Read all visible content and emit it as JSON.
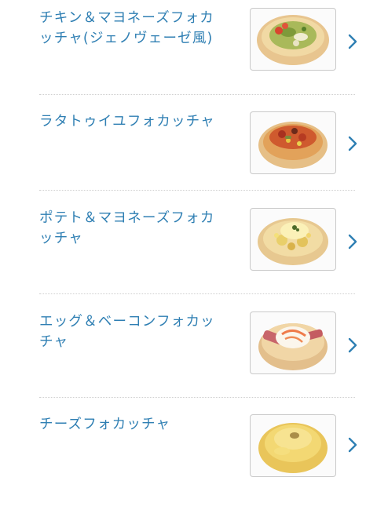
{
  "colors": {
    "item_text": "#2f7fb3",
    "chevron": "#2f7fb3",
    "divider": "#cfcfcf",
    "thumb_border": "#c9c9c9"
  },
  "items": [
    {
      "name": "チキン＆マヨネーズフォカ\nッチャ(ジェノヴェーゼ風)",
      "image": "chicken-mayo-genovese-focaccia",
      "icon": "chevron-right-icon"
    },
    {
      "name": "ラタトゥイユフォカッチャ",
      "image": "ratatouille-focaccia",
      "icon": "chevron-right-icon"
    },
    {
      "name": "ポテト＆マヨネーズフォカ\nッチャ",
      "image": "potato-mayo-focaccia",
      "icon": "chevron-right-icon"
    },
    {
      "name": "エッグ＆ベーコンフォカッ\nチャ",
      "image": "egg-bacon-focaccia",
      "icon": "chevron-right-icon"
    },
    {
      "name": "チーズフォカッチャ",
      "image": "cheese-focaccia",
      "icon": "chevron-right-icon"
    }
  ]
}
